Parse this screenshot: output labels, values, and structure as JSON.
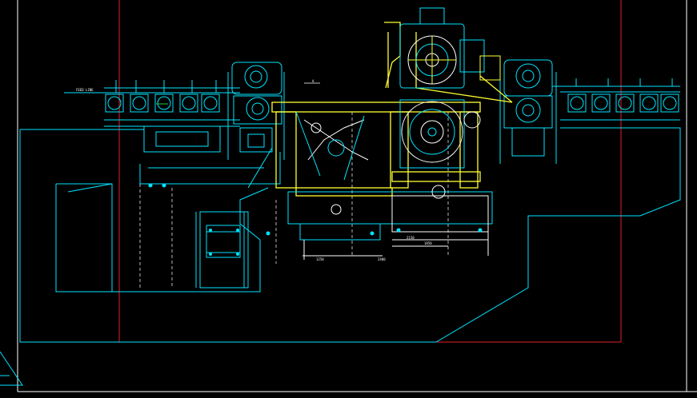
{
  "colors": {
    "background": "#000000",
    "cyan": "#00e5ff",
    "yellow": "#ffff33",
    "white": "#ffffff",
    "red_border": "#e0202a",
    "green": "#22cc44"
  },
  "drawing": {
    "labels": {
      "left_rail_tag": "FEED LINE",
      "center_arrow_tag": "A",
      "dim_left_a": "1250",
      "dim_left_b": "2400",
      "dim_center": "2150",
      "dim_right": "1850"
    },
    "icons": {
      "ucs_icon": "ucs-triangle-icon"
    }
  }
}
